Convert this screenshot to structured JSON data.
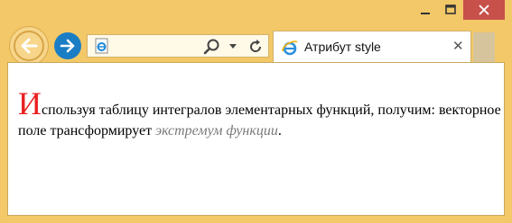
{
  "tab": {
    "title": "Атрибут style"
  },
  "page": {
    "first_letter": "И",
    "text_before": "спользуя таблицу интегралов элементарных функций, получим: векторное поле трансформирует ",
    "emphasis": "экстремум функции",
    "text_after": "."
  },
  "colors": {
    "frame": "#f3c868",
    "first_letter": "#ea1f1f",
    "emphasis": "#7a7a7a",
    "close_button": "#c7504a",
    "forward_button": "#1b7ec4"
  },
  "icons": {
    "back": "back-arrow-icon",
    "forward": "forward-arrow-icon",
    "page": "ie-page-icon",
    "search": "search-icon",
    "dropdown": "dropdown-arrow-icon",
    "refresh": "refresh-icon",
    "tab": "ie-logo-icon",
    "tab_close": "close-tab-icon",
    "minimize": "minimize-icon",
    "maximize": "maximize-icon",
    "close": "close-window-icon"
  }
}
